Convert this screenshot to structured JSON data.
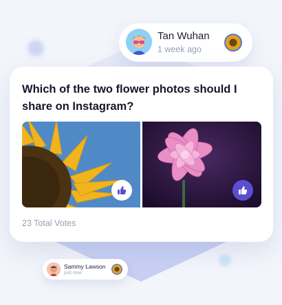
{
  "poster": {
    "name": "Tan Wuhan",
    "time": "1 week ago",
    "avatar_icon": "memoji-avatar-icon",
    "attachment_icon": "sunflower-thumbnail-icon"
  },
  "poll": {
    "question": "Which of the two flower photos should I share on Instagram?",
    "options": [
      {
        "image": "sunflower-photo",
        "vote_icon": "thumbs-up-icon",
        "selected": false
      },
      {
        "image": "pink-dahlia-photo",
        "vote_icon": "thumbs-up-icon",
        "selected": true
      }
    ],
    "total_votes": "23 Total Votes"
  },
  "commenter": {
    "name": "Sammy Lawson",
    "time": "just now",
    "avatar_icon": "memoji-avatar-icon",
    "attachment_icon": "sunflower-thumbnail-icon"
  },
  "colors": {
    "accent": "#5a4fd0",
    "background": "#f3f5fb",
    "muted_text": "#9aa0b4"
  }
}
